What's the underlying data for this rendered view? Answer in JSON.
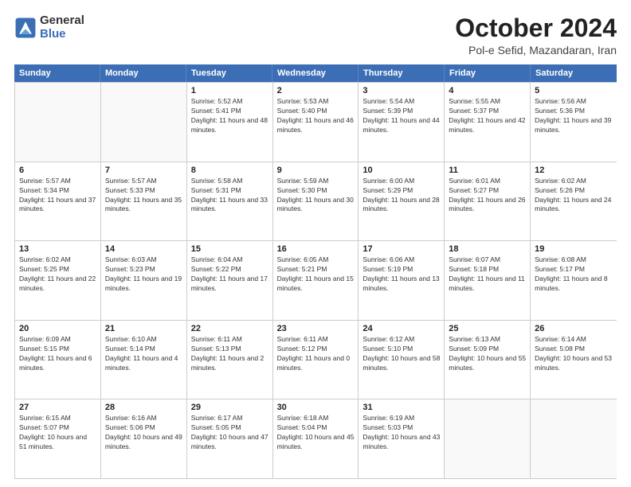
{
  "logo": {
    "general": "General",
    "blue": "Blue"
  },
  "title": "October 2024",
  "location": "Pol-e Sefid, Mazandaran, Iran",
  "weekdays": [
    "Sunday",
    "Monday",
    "Tuesday",
    "Wednesday",
    "Thursday",
    "Friday",
    "Saturday"
  ],
  "weeks": [
    [
      {
        "day": "",
        "info": ""
      },
      {
        "day": "",
        "info": ""
      },
      {
        "day": "1",
        "info": "Sunrise: 5:52 AM\nSunset: 5:41 PM\nDaylight: 11 hours and 48 minutes."
      },
      {
        "day": "2",
        "info": "Sunrise: 5:53 AM\nSunset: 5:40 PM\nDaylight: 11 hours and 46 minutes."
      },
      {
        "day": "3",
        "info": "Sunrise: 5:54 AM\nSunset: 5:39 PM\nDaylight: 11 hours and 44 minutes."
      },
      {
        "day": "4",
        "info": "Sunrise: 5:55 AM\nSunset: 5:37 PM\nDaylight: 11 hours and 42 minutes."
      },
      {
        "day": "5",
        "info": "Sunrise: 5:56 AM\nSunset: 5:36 PM\nDaylight: 11 hours and 39 minutes."
      }
    ],
    [
      {
        "day": "6",
        "info": "Sunrise: 5:57 AM\nSunset: 5:34 PM\nDaylight: 11 hours and 37 minutes."
      },
      {
        "day": "7",
        "info": "Sunrise: 5:57 AM\nSunset: 5:33 PM\nDaylight: 11 hours and 35 minutes."
      },
      {
        "day": "8",
        "info": "Sunrise: 5:58 AM\nSunset: 5:31 PM\nDaylight: 11 hours and 33 minutes."
      },
      {
        "day": "9",
        "info": "Sunrise: 5:59 AM\nSunset: 5:30 PM\nDaylight: 11 hours and 30 minutes."
      },
      {
        "day": "10",
        "info": "Sunrise: 6:00 AM\nSunset: 5:29 PM\nDaylight: 11 hours and 28 minutes."
      },
      {
        "day": "11",
        "info": "Sunrise: 6:01 AM\nSunset: 5:27 PM\nDaylight: 11 hours and 26 minutes."
      },
      {
        "day": "12",
        "info": "Sunrise: 6:02 AM\nSunset: 5:26 PM\nDaylight: 11 hours and 24 minutes."
      }
    ],
    [
      {
        "day": "13",
        "info": "Sunrise: 6:02 AM\nSunset: 5:25 PM\nDaylight: 11 hours and 22 minutes."
      },
      {
        "day": "14",
        "info": "Sunrise: 6:03 AM\nSunset: 5:23 PM\nDaylight: 11 hours and 19 minutes."
      },
      {
        "day": "15",
        "info": "Sunrise: 6:04 AM\nSunset: 5:22 PM\nDaylight: 11 hours and 17 minutes."
      },
      {
        "day": "16",
        "info": "Sunrise: 6:05 AM\nSunset: 5:21 PM\nDaylight: 11 hours and 15 minutes."
      },
      {
        "day": "17",
        "info": "Sunrise: 6:06 AM\nSunset: 5:19 PM\nDaylight: 11 hours and 13 minutes."
      },
      {
        "day": "18",
        "info": "Sunrise: 6:07 AM\nSunset: 5:18 PM\nDaylight: 11 hours and 11 minutes."
      },
      {
        "day": "19",
        "info": "Sunrise: 6:08 AM\nSunset: 5:17 PM\nDaylight: 11 hours and 8 minutes."
      }
    ],
    [
      {
        "day": "20",
        "info": "Sunrise: 6:09 AM\nSunset: 5:15 PM\nDaylight: 11 hours and 6 minutes."
      },
      {
        "day": "21",
        "info": "Sunrise: 6:10 AM\nSunset: 5:14 PM\nDaylight: 11 hours and 4 minutes."
      },
      {
        "day": "22",
        "info": "Sunrise: 6:11 AM\nSunset: 5:13 PM\nDaylight: 11 hours and 2 minutes."
      },
      {
        "day": "23",
        "info": "Sunrise: 6:11 AM\nSunset: 5:12 PM\nDaylight: 11 hours and 0 minutes."
      },
      {
        "day": "24",
        "info": "Sunrise: 6:12 AM\nSunset: 5:10 PM\nDaylight: 10 hours and 58 minutes."
      },
      {
        "day": "25",
        "info": "Sunrise: 6:13 AM\nSunset: 5:09 PM\nDaylight: 10 hours and 55 minutes."
      },
      {
        "day": "26",
        "info": "Sunrise: 6:14 AM\nSunset: 5:08 PM\nDaylight: 10 hours and 53 minutes."
      }
    ],
    [
      {
        "day": "27",
        "info": "Sunrise: 6:15 AM\nSunset: 5:07 PM\nDaylight: 10 hours and 51 minutes."
      },
      {
        "day": "28",
        "info": "Sunrise: 6:16 AM\nSunset: 5:06 PM\nDaylight: 10 hours and 49 minutes."
      },
      {
        "day": "29",
        "info": "Sunrise: 6:17 AM\nSunset: 5:05 PM\nDaylight: 10 hours and 47 minutes."
      },
      {
        "day": "30",
        "info": "Sunrise: 6:18 AM\nSunset: 5:04 PM\nDaylight: 10 hours and 45 minutes."
      },
      {
        "day": "31",
        "info": "Sunrise: 6:19 AM\nSunset: 5:03 PM\nDaylight: 10 hours and 43 minutes."
      },
      {
        "day": "",
        "info": ""
      },
      {
        "day": "",
        "info": ""
      }
    ]
  ]
}
